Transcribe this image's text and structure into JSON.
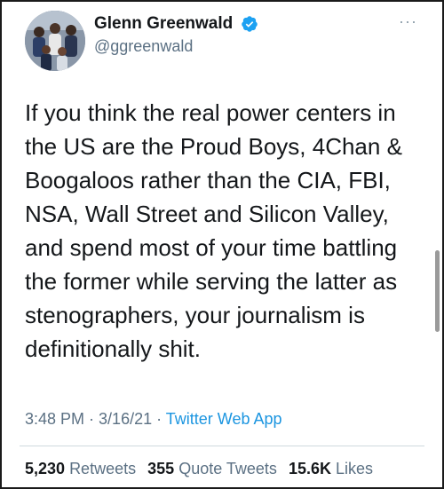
{
  "author": {
    "display_name": "Glenn Greenwald",
    "handle": "@ggreenwald",
    "verified_icon": "verified-badge-icon",
    "verified_color": "#1da1f2"
  },
  "menu_icon": "···",
  "tweet": {
    "lines": [
      "If you think the real power centers in",
      "the US are the Proud Boys, 4Chan &",
      "Boogaloos rather than the CIA, FBI,",
      "NSA, Wall Street and Silicon Valley,",
      "and spend most of your time battling",
      "the former while serving the latter as",
      "stenographers, your journalism is",
      "definitionally shit."
    ]
  },
  "meta": {
    "time": "3:48 PM",
    "date": "3/16/21",
    "separator1": " · ",
    "separator2": " · ",
    "source": "Twitter Web App"
  },
  "stats": {
    "retweets_count": "5,230",
    "retweets_label": "Retweets",
    "quotes_count": "355",
    "quotes_label": "Quote Tweets",
    "likes_count": "15.6K",
    "likes_label": "Likes"
  },
  "colors": {
    "text": "#14171a",
    "muted": "#5b7083",
    "link": "#1b95e0"
  }
}
